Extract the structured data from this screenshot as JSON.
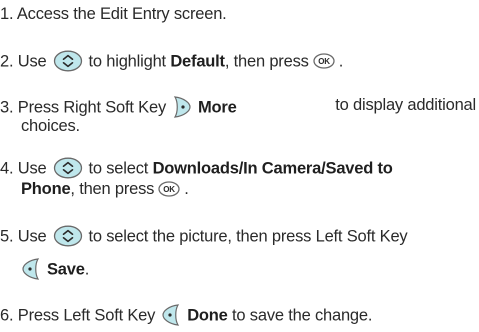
{
  "steps": [
    {
      "num": "1.",
      "text": "Access the Edit Entry screen."
    },
    {
      "num": "2.",
      "pre": "Use",
      "mid": "to highlight",
      "bold": "Default",
      "post": ", then press",
      "end": "."
    },
    {
      "num": "3.",
      "pre": "Press Right Soft Key",
      "bold": "More",
      "post": "to display additional",
      "cont": "choices."
    },
    {
      "num": "4.",
      "pre": "Use",
      "mid": "to select",
      "bold": "Downloads/In Camera/Saved to",
      "cont_bold": "Phone",
      "cont": ", then press",
      "end": "."
    },
    {
      "num": "5.",
      "pre": "Use",
      "mid": "to select the picture, then press Left Soft Key",
      "bold": "Save",
      "end": "."
    },
    {
      "num": "6.",
      "pre": "Press Left Soft Key",
      "bold": "Done",
      "post": "to save the change."
    }
  ],
  "icons": {
    "nav": "nav-key-icon",
    "ok": "ok-key-icon",
    "right_soft": "right-soft-key-icon",
    "left_soft": "left-soft-key-icon",
    "ok_label": "OK"
  },
  "colors": {
    "text": "#2a2a2a",
    "key_fill": "#bfe7ec",
    "key_stroke": "#6a6a6a"
  }
}
